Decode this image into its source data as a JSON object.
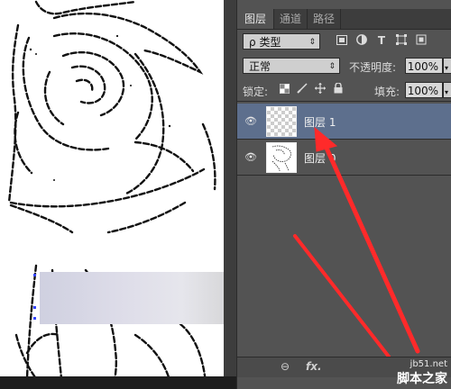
{
  "panel": {
    "tabs": [
      {
        "label": "图层",
        "active": true
      },
      {
        "label": "通道",
        "active": false
      },
      {
        "label": "路径",
        "active": false
      }
    ],
    "filter": {
      "search_glyph": "ρ",
      "value": "类型"
    },
    "filter_icons": [
      "image-filter-icon",
      "adjustment-filter-icon",
      "type-filter-icon",
      "shape-filter-icon",
      "smartobject-filter-icon"
    ],
    "blend_mode": "正常",
    "opacity": {
      "label": "不透明度:",
      "value": "100%"
    },
    "lock": {
      "label": "锁定:"
    },
    "lock_icons": [
      "lock-transparency-icon",
      "lock-image-icon",
      "lock-position-icon",
      "lock-all-icon"
    ],
    "fill": {
      "label": "填充:",
      "value": "100%"
    },
    "layers": [
      {
        "name": "图层 1",
        "selected": true,
        "visible": true,
        "thumb": "transparent"
      },
      {
        "name": "图层 0",
        "selected": false,
        "visible": true,
        "thumb": "sketch"
      }
    ],
    "footer": {
      "link_glyph": "⊖",
      "fx_label": "fx."
    }
  },
  "watermark": {
    "url": "jb51.net",
    "name": "脚本之家"
  },
  "colors": {
    "panel_bg": "#535353",
    "selected_row": "#5d6f8d",
    "arrow": "#ff2a2a",
    "canvas_bg": "#ffffff"
  }
}
